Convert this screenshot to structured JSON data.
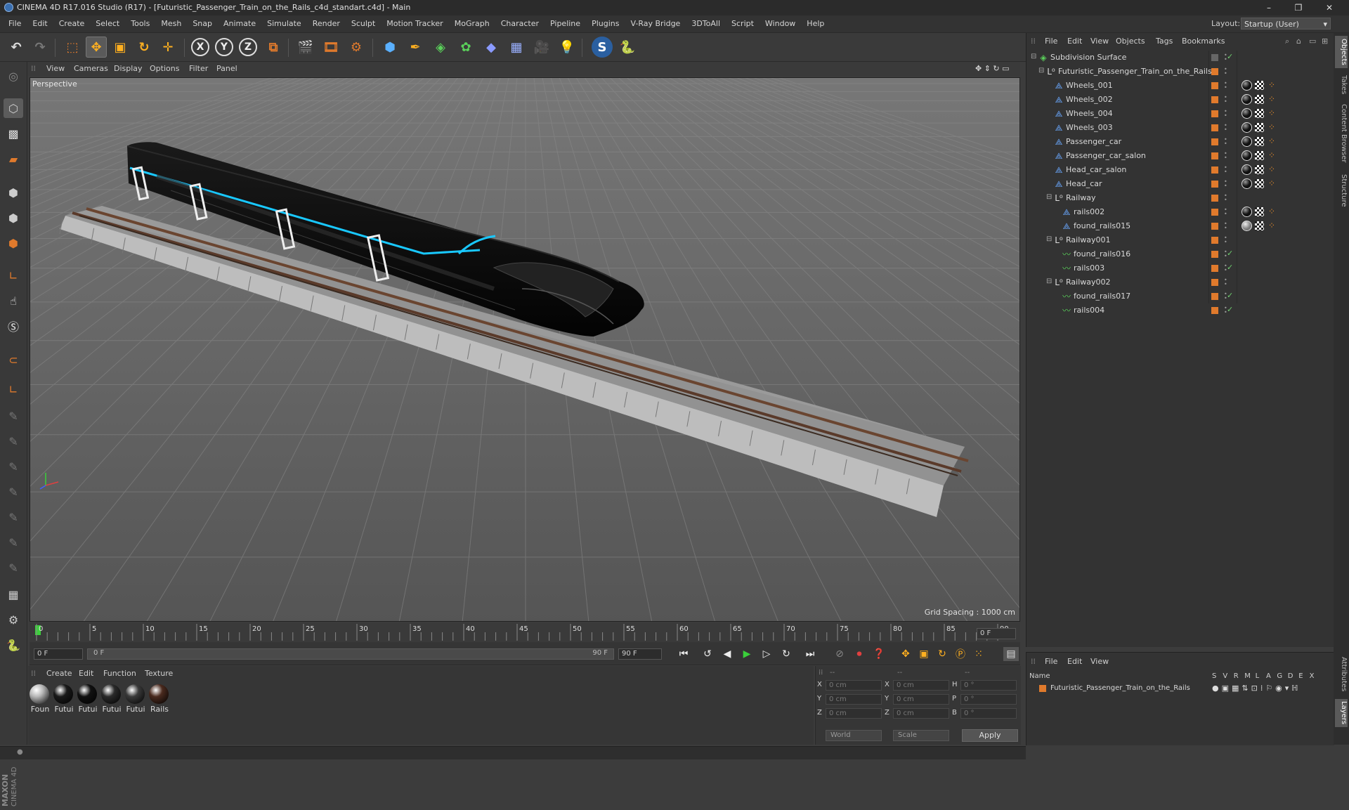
{
  "window": {
    "title": "CINEMA 4D R17.016 Studio (R17) - [Futuristic_Passenger_Train_on_the_Rails_c4d_standart.c4d] - Main",
    "minimize": "–",
    "maximize": "❐",
    "close": "✕"
  },
  "menu": [
    "File",
    "Edit",
    "Create",
    "Select",
    "Tools",
    "Mesh",
    "Snap",
    "Animate",
    "Simulate",
    "Render",
    "Sculpt",
    "Motion Tracker",
    "MoGraph",
    "Character",
    "Pipeline",
    "Plugins",
    "V-Ray Bridge",
    "3DToAll",
    "Script",
    "Window",
    "Help"
  ],
  "layout": {
    "label": "Layout:",
    "value": "Startup (User)"
  },
  "toolbar": {
    "x": "X",
    "y": "Y",
    "z": "Z"
  },
  "viewport": {
    "menu": [
      "View",
      "Cameras",
      "Display",
      "Options",
      "Filter",
      "Panel"
    ],
    "label": "Perspective",
    "grid_spacing": "Grid Spacing : 1000 cm"
  },
  "timeline": {
    "ticks": [
      "0",
      "5",
      "10",
      "15",
      "20",
      "25",
      "30",
      "35",
      "40",
      "45",
      "50",
      "55",
      "60",
      "65",
      "70",
      "75",
      "80",
      "85",
      "90"
    ],
    "current_frame": "0 F",
    "start_field": "0 F",
    "range_start": "0 F",
    "range_end": "90 F",
    "end_field": "90 F"
  },
  "materials": {
    "menu": [
      "Create",
      "Edit",
      "Function",
      "Texture"
    ],
    "items": [
      {
        "label": "Foun",
        "color": "#b8b8b8"
      },
      {
        "label": "Futui",
        "color": "#1a1a1a"
      },
      {
        "label": "Futui",
        "color": "#111111"
      },
      {
        "label": "Futui",
        "color": "#2a2a2a"
      },
      {
        "label": "Futui",
        "color": "#3a3a3a"
      },
      {
        "label": "Rails",
        "color": "#4a2a1e"
      }
    ]
  },
  "coords": {
    "header": [
      "--",
      "--",
      "--"
    ],
    "rows": [
      {
        "a": "X",
        "av": "0 cm",
        "b": "X",
        "bv": "0 cm",
        "c": "H",
        "cv": "0 °"
      },
      {
        "a": "Y",
        "av": "0 cm",
        "b": "Y",
        "bv": "0 cm",
        "c": "P",
        "cv": "0 °"
      },
      {
        "a": "Z",
        "av": "0 cm",
        "b": "Z",
        "bv": "0 cm",
        "c": "B",
        "cv": "0 °"
      }
    ],
    "world": "World",
    "scale": "Scale",
    "apply": "Apply"
  },
  "objects": {
    "menu": [
      "File",
      "Edit",
      "View",
      "Objects",
      "Tags",
      "Bookmarks"
    ],
    "rows": [
      {
        "name": "Subdivision Surface",
        "level": 0,
        "kind": "subdiv",
        "check": true,
        "tags": []
      },
      {
        "name": "Futuristic_Passenger_Train_on_the_Rails",
        "level": 1,
        "kind": "null",
        "check": false,
        "tags": []
      },
      {
        "name": "Wheels_001",
        "level": 2,
        "kind": "poly",
        "check": false,
        "tags": [
          "mat",
          "chk",
          "sph"
        ]
      },
      {
        "name": "Wheels_002",
        "level": 2,
        "kind": "poly",
        "check": false,
        "tags": [
          "mat",
          "chk",
          "sph"
        ]
      },
      {
        "name": "Wheels_004",
        "level": 2,
        "kind": "poly",
        "check": false,
        "tags": [
          "mat",
          "chk",
          "sph"
        ]
      },
      {
        "name": "Wheels_003",
        "level": 2,
        "kind": "poly",
        "check": false,
        "tags": [
          "mat",
          "chk",
          "sph"
        ]
      },
      {
        "name": "Passenger_car",
        "level": 2,
        "kind": "poly",
        "check": false,
        "tags": [
          "mat",
          "chk",
          "sph"
        ]
      },
      {
        "name": "Passenger_car_salon",
        "level": 2,
        "kind": "poly",
        "check": false,
        "tags": [
          "mat",
          "chk",
          "sph"
        ]
      },
      {
        "name": "Head_car_salon",
        "level": 2,
        "kind": "poly",
        "check": false,
        "tags": [
          "mat",
          "chk",
          "sph"
        ]
      },
      {
        "name": "Head_car",
        "level": 2,
        "kind": "poly",
        "check": false,
        "tags": [
          "mat",
          "chk",
          "sph"
        ]
      },
      {
        "name": "Railway",
        "level": 2,
        "kind": "null",
        "check": false,
        "tags": []
      },
      {
        "name": "rails002",
        "level": 3,
        "kind": "poly",
        "check": false,
        "tags": [
          "mat",
          "chk",
          "sph"
        ]
      },
      {
        "name": "found_rails015",
        "level": 3,
        "kind": "poly",
        "check": false,
        "tags": [
          "matg",
          "chk",
          "sph"
        ]
      },
      {
        "name": "Railway001",
        "level": 2,
        "kind": "null",
        "check": false,
        "tags": []
      },
      {
        "name": "found_rails016",
        "level": 3,
        "kind": "spline",
        "check": true,
        "tags": []
      },
      {
        "name": "rails003",
        "level": 3,
        "kind": "spline",
        "check": true,
        "tags": []
      },
      {
        "name": "Railway002",
        "level": 2,
        "kind": "null",
        "check": false,
        "tags": []
      },
      {
        "name": "found_rails017",
        "level": 3,
        "kind": "spline",
        "check": true,
        "tags": []
      },
      {
        "name": "rails004",
        "level": 3,
        "kind": "spline",
        "check": true,
        "tags": []
      }
    ]
  },
  "layers": {
    "menu": [
      "File",
      "Edit",
      "View"
    ],
    "columns": {
      "name": "Name",
      "flags": [
        "S",
        "V",
        "R",
        "M",
        "L",
        "A",
        "G",
        "D",
        "E",
        "X"
      ]
    },
    "row": "Futuristic_Passenger_Train_on_the_Rails"
  },
  "right_tabs": [
    "Objects",
    "Takes",
    "Content Browser",
    "Structure",
    "Attributes",
    "Layers"
  ],
  "brand": {
    "maxon": "MAXON",
    "cinema": "CINEMA 4D"
  },
  "colors": {
    "accent": "#e07a2c",
    "train_glow": "#19c8ff"
  }
}
